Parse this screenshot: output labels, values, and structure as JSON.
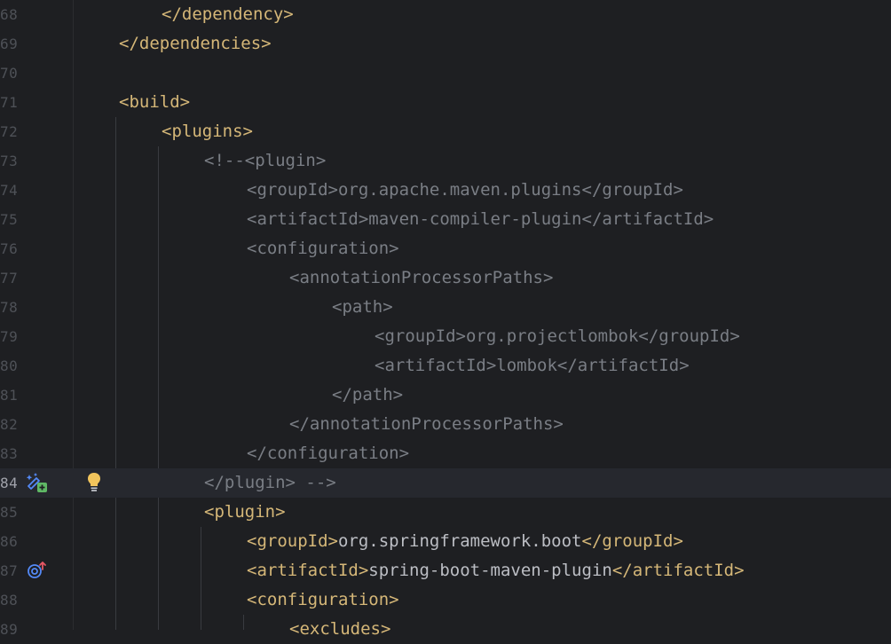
{
  "editor": {
    "lines": [
      {
        "num": "68",
        "code": "</dependency>"
      },
      {
        "num": "69",
        "code": "</dependencies>"
      },
      {
        "num": "70",
        "code": ""
      },
      {
        "num": "71",
        "code": "<build>"
      },
      {
        "num": "72",
        "code": "<plugins>"
      },
      {
        "num": "73",
        "code": "<!--<plugin>"
      },
      {
        "num": "74",
        "code_open": "<groupId>",
        "code_text": "org.apache.maven.plugins",
        "code_close": "</groupId>"
      },
      {
        "num": "75",
        "code_open": "<artifactId>",
        "code_text": "maven-compiler-plugin",
        "code_close": "</artifactId>"
      },
      {
        "num": "76",
        "code": "<configuration>"
      },
      {
        "num": "77",
        "code": "<annotationProcessorPaths>"
      },
      {
        "num": "78",
        "code": "<path>"
      },
      {
        "num": "79",
        "code_open": "<groupId>",
        "code_text": "org.projectlombok",
        "code_close": "</groupId>"
      },
      {
        "num": "80",
        "code_open": "<artifactId>",
        "code_text": "lombok",
        "code_close": "</artifactId>"
      },
      {
        "num": "81",
        "code": "</path>"
      },
      {
        "num": "82",
        "code": "</annotationProcessorPaths>"
      },
      {
        "num": "83",
        "code": "</configuration>"
      },
      {
        "num": "84",
        "code": "</plugin> -->"
      },
      {
        "num": "85",
        "code": "<plugin>"
      },
      {
        "num": "86",
        "code_open": "<groupId>",
        "code_text": "org.springframework.boot",
        "code_close": "</groupId>"
      },
      {
        "num": "87",
        "code_open": "<artifactId>",
        "code_text": "spring-boot-maven-plugin",
        "code_close": "</artifactId>"
      },
      {
        "num": "88",
        "code": "<configuration>"
      },
      {
        "num": "89",
        "code": "<excludes>"
      }
    ]
  },
  "gutter_icons": {
    "line84": [
      "add-dependency-icon",
      "intention-bulb-icon"
    ],
    "line87": [
      "override-up-icon"
    ]
  },
  "colors": {
    "background": "#1e1f22",
    "tag": "#d5b778",
    "comment": "#7a7e85",
    "text": "#bcbec4",
    "line_number": "#4e5157",
    "current_line": "#26282e"
  }
}
